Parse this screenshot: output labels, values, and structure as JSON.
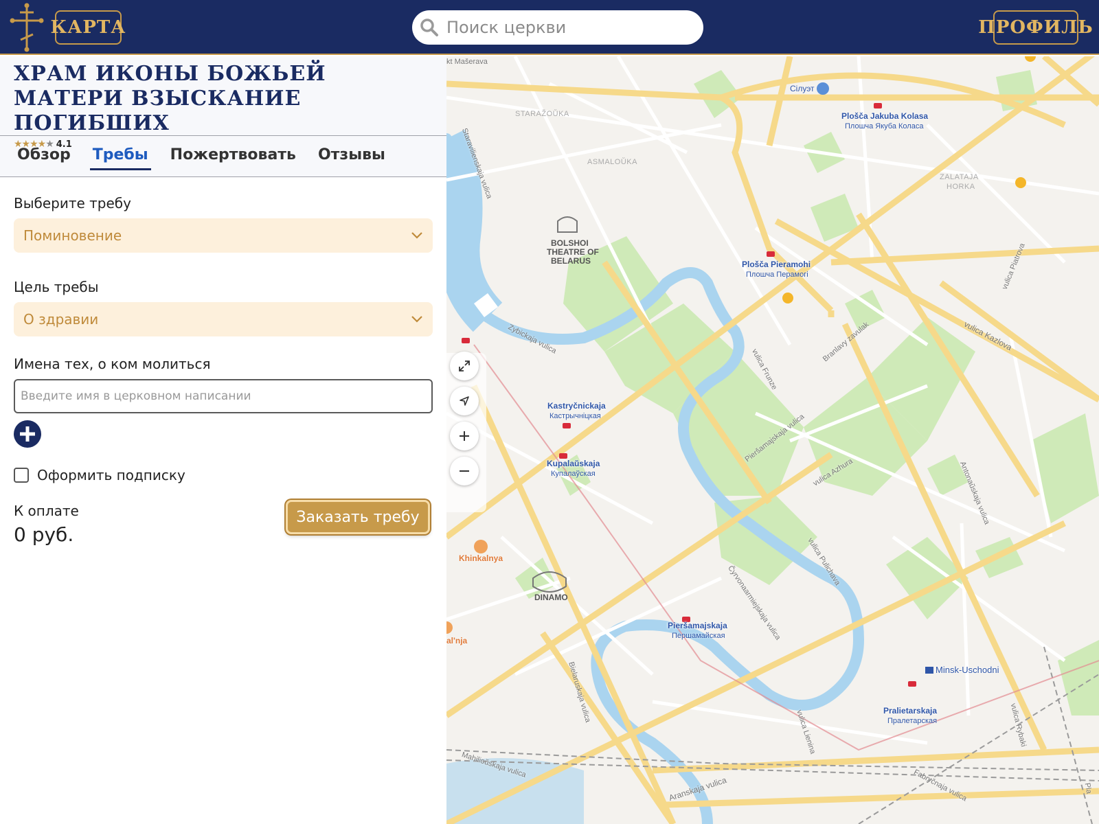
{
  "header": {
    "map_button": "КАРТА",
    "profile_button": "ПРОФИЛЬ",
    "search_placeholder": "Поиск церкви"
  },
  "church": {
    "title": "Храм иконы Божьей Матери Взыскание погибших",
    "rating": "4.1",
    "rating_stars": 4
  },
  "tabs": [
    {
      "label": "Обзор",
      "active": false
    },
    {
      "label": "Требы",
      "active": true
    },
    {
      "label": "Пожертвовать",
      "active": false
    },
    {
      "label": "Отзывы",
      "active": false
    }
  ],
  "form": {
    "treba_label": "Выберите требу",
    "treba_value": "Поминовение",
    "purpose_label": "Цель требы",
    "purpose_value": "О здравии",
    "names_label": "Имена тех, о ком молиться",
    "names_placeholder": "Введите имя в церковном написании",
    "subscription_label": "Оформить подписку",
    "payment_label": "К оплате",
    "payment_value": "0 руб.",
    "order_button": "Заказать требу"
  },
  "colors": {
    "header_bg": "#1a2b62",
    "gold": "#c79a4a",
    "select_bg": "#fdf0dc",
    "active_tab": "#1e5bbf"
  },
  "map": {
    "labels": {
      "masherava": "kt Mašerava",
      "siluet": "Сілуэт",
      "kolasa": "Plošča Jakuba Kolasa",
      "kolasa_ru": "Плошча Якуба Коласа",
      "starazouka": "STARAŽOŬKA",
      "asmalouka": "ASMALOŬKA",
      "zalataja": "ZALATAJA",
      "horka": "HORKA",
      "staravilenskaja": "Staravilienskaja vulica",
      "bolshoi_1": "BOLSHOI",
      "bolshoi_2": "THEATRE OF",
      "bolshoi_3": "BELARUS",
      "pieramohi": "Plošča Pieramohi",
      "pieramohi_ru": "Плошча Перамогі",
      "piatrova": "vulica Piatrova",
      "kazlova": "vulica Kazlova",
      "branlavy": "Branlavy zavulak",
      "zybickaja": "Zybickaja vulica",
      "frunze": "vulica Frunze",
      "kastrycnickaja": "Kastryčnickaja",
      "kastrycnickaja_ru": "Кастрычніцкая",
      "piersamajskaja_st": "Pieršamajskaja vulica",
      "kupalauskaja": "Kupalaŭskaja",
      "kupalauskaja_ru": "Купалаўская",
      "azhura": "vulica Azhura",
      "antanauskaja": "Antonaŭskaja vulica",
      "khinkalnya": "Khinkalnya",
      "dinamo": "DINAMO",
      "pulichava": "vulica Pulichava",
      "cyrvonaarm": "Čyrvonaarmiejskaja vulica",
      "piersamajskaja": "Pieršamajskaja",
      "piersamajskaja_ru": "Першамайская",
      "alnja": "al'nja",
      "uschodni": "Minsk-Uschodni",
      "pralietarskaja": "Pralietarskaja",
      "pralietarskaja_ru": "Пралетарская",
      "bielaruskaja": "Bielaruskaja vulica",
      "lienina": "vulica Lienina",
      "rybaki": "vulica Rybaki",
      "mahiliouskaja": "Mahilioŭskaja vulica",
      "aranskaja": "Aranskaja vulica",
      "fabrycnaja": "Fabryčnaja vulica",
      "pia": "Pla"
    }
  }
}
